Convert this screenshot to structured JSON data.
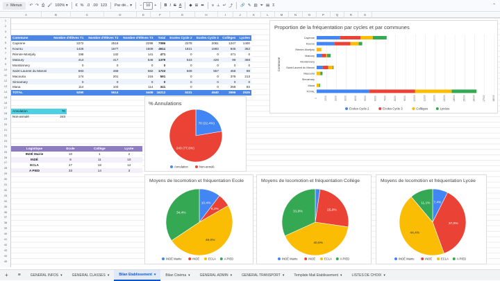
{
  "toolbar": {
    "menus_label": "Menus",
    "zoom": "100%",
    "currency": "€",
    "percent": "%",
    "dec_dec": ".0",
    "dec_inc": ".00",
    "format_123": "123",
    "font": "Par dé...",
    "font_size": "10",
    "minus": "−",
    "plus": "+",
    "bold": "B",
    "italic": "I",
    "strike": "S",
    "text_color": "A"
  },
  "columns": [
    "A",
    "B",
    "C",
    "D",
    "E",
    "F",
    "G",
    "H",
    "I",
    "J",
    "K",
    "L",
    "M",
    "N",
    "O",
    "P",
    "Q",
    "R",
    "S"
  ],
  "rows": [
    "1",
    "2",
    "3",
    "4",
    "5",
    "6",
    "7",
    "8",
    "9",
    "10",
    "11",
    "12",
    "13",
    "14",
    "15",
    "16",
    "17",
    "18",
    "19",
    "20",
    "21",
    "22",
    "23",
    "24",
    "25",
    "26",
    "27",
    "28",
    "29",
    "30",
    "31",
    "32",
    "33",
    "34",
    "35",
    "36",
    "37",
    "38",
    "39",
    "40",
    "41",
    "42",
    "43",
    "44",
    "45"
  ],
  "main_table": {
    "headers": [
      "Commune",
      "Nombre d'élèves T1",
      "Nombre d'élèves T2",
      "Nombre d'élèves T3",
      "Total",
      "Ecoles Cycle 2",
      "Ecoles Cycle 3",
      "Collèges",
      "Lycées"
    ],
    "rows": [
      [
        "Cayenne",
        "2272",
        "2516",
        "2298",
        "7086",
        "2378",
        "2061",
        "1247",
        "1400"
      ],
      [
        "Kourou",
        "1425",
        "1677",
        "1509",
        "4611",
        "1821",
        "1593",
        "845",
        "352"
      ],
      [
        "Rémire-Montjoly",
        "198",
        "132",
        "141",
        "471",
        "0",
        "0",
        "471",
        "0"
      ],
      [
        "Matoury",
        "414",
        "417",
        "548",
        "1379",
        "523",
        "429",
        "99",
        "368"
      ],
      [
        "Montsinnery",
        "0",
        "0",
        "0",
        "0",
        "0",
        "0",
        "0",
        "0"
      ],
      [
        "Saint-Laurent du Maroni",
        "693",
        "468",
        "582",
        "1723",
        "609",
        "557",
        "458",
        "89"
      ],
      [
        "Macouria",
        "174",
        "201",
        "216",
        "591",
        "0",
        "0",
        "378",
        "213"
      ],
      [
        "Sinnamary",
        "0",
        "0",
        "0",
        "0",
        "0",
        "0",
        "0",
        "0"
      ],
      [
        "Mana",
        "114",
        "103",
        "114",
        "341",
        "0",
        "0",
        "258",
        "83"
      ]
    ],
    "total": [
      "TOTAL",
      "5290",
      "5514",
      "5408",
      "16212",
      "5331",
      "4640",
      "3696",
      "2525"
    ]
  },
  "annul_table": {
    "rows": [
      [
        "Annulation",
        "70"
      ],
      [
        "Non-annulé",
        "243"
      ]
    ]
  },
  "transport_table": {
    "headers": [
      "Logistique",
      "Ecole",
      "Collège",
      "Lycée"
    ],
    "rows": [
      [
        "INDÉ Mairie",
        "10",
        "1",
        "2"
      ],
      [
        "INDÉ",
        "6",
        "11",
        "10"
      ],
      [
        "ECLA",
        "47",
        "18",
        "12"
      ],
      [
        "A PIED",
        "33",
        "14",
        "3"
      ]
    ]
  },
  "colors": {
    "blue": "#4285f4",
    "red": "#ea4335",
    "yellow": "#fbbc04",
    "green": "#34a853",
    "header_blue": "#4a86e8",
    "cyan": "#4dd0e1",
    "purple": "#8e7cc3"
  },
  "chart_data": [
    {
      "type": "bar",
      "title": "Proportion de la fréquentation par cycles et par communes",
      "ylabel": "Commune",
      "categories": [
        "Cayenne",
        "Kourou",
        "Rémire-Montjoly",
        "Matoury",
        "Montsinnery",
        "Saint-Laurent du Maroni",
        "Macouria",
        "Sinnamary",
        "Mana",
        "TOTAL"
      ],
      "series": [
        {
          "name": "Ecoles Cycle 2",
          "values": [
            2378,
            1821,
            0,
            523,
            0,
            609,
            0,
            0,
            0,
            5331
          ]
        },
        {
          "name": "Ecoles Cycle 3",
          "values": [
            2061,
            1593,
            0,
            429,
            0,
            557,
            0,
            0,
            0,
            4640
          ]
        },
        {
          "name": "Collèges",
          "values": [
            1247,
            845,
            471,
            99,
            0,
            458,
            378,
            0,
            258,
            3696
          ]
        },
        {
          "name": "Lycées",
          "values": [
            1400,
            352,
            0,
            368,
            0,
            89,
            213,
            0,
            83,
            2525
          ]
        }
      ],
      "xticks": [
        "0",
        "1000",
        "2000",
        "3000",
        "4000",
        "5000",
        "6000",
        "7000",
        "8000",
        "9000",
        "10000",
        "11000",
        "12000",
        "13000",
        "14000",
        "15000",
        "16000",
        "17000",
        "18000"
      ],
      "xlim": [
        0,
        18000
      ],
      "legend": "bottom"
    },
    {
      "type": "pie",
      "title": "% Annulations",
      "categories": [
        "Annulation",
        "Non-annulé"
      ],
      "values": [
        70,
        243
      ],
      "labels": [
        "70 (22,4%)",
        "243 (77,6%)"
      ],
      "legend": "bottom"
    },
    {
      "type": "pie",
      "title": "Moyens de locomotion et fréquentation Ecole",
      "categories": [
        "INDÉ Mairie",
        "INDÉ",
        "ECLA",
        "A PIED"
      ],
      "values": [
        10.4,
        6.3,
        49.0,
        34.4
      ],
      "labels": [
        "10,4%",
        "6,3%",
        "49,0%",
        "34,4%"
      ],
      "legend": "bottom"
    },
    {
      "type": "pie",
      "title": "Moyens de locomotion et fréquentation Collège",
      "categories": [
        "INDÉ Mairie",
        "INDÉ",
        "ECLA",
        "A PIED"
      ],
      "values": [
        2.3,
        25.0,
        40.9,
        31.8
      ],
      "labels": [
        "",
        "25,0%",
        "40,9%",
        "31,8%"
      ],
      "legend": "bottom"
    },
    {
      "type": "pie",
      "title": "Moyens de locomotion et fréquentation Lycée",
      "categories": [
        "INDÉ Mairie",
        "INDÉ",
        "ECLA",
        "A PIED"
      ],
      "values": [
        7.4,
        37.0,
        44.4,
        11.1
      ],
      "labels": [
        "7,4%",
        "37,0%",
        "44,4%",
        "11,1%"
      ],
      "legend": "bottom"
    }
  ],
  "tabs": [
    {
      "label": "GENERAL INFOS",
      "arrow": "▾"
    },
    {
      "label": "GENERAL CLASSES",
      "arrow": "▾"
    },
    {
      "label": "Bilan Etablissement",
      "arrow": "▾"
    },
    {
      "label": "Bilan Cinéma",
      "arrow": "▾"
    },
    {
      "label": "GENERAL ADMIN",
      "arrow": "▾"
    },
    {
      "label": "GENERAL TRANSPORT",
      "arrow": "▾"
    },
    {
      "label": "Template Mail Etablissement",
      "arrow": "▾"
    },
    {
      "label": "LISTES DE CHOIX",
      "arrow": "▾"
    }
  ],
  "tab_add": "+",
  "tab_list": "≡"
}
